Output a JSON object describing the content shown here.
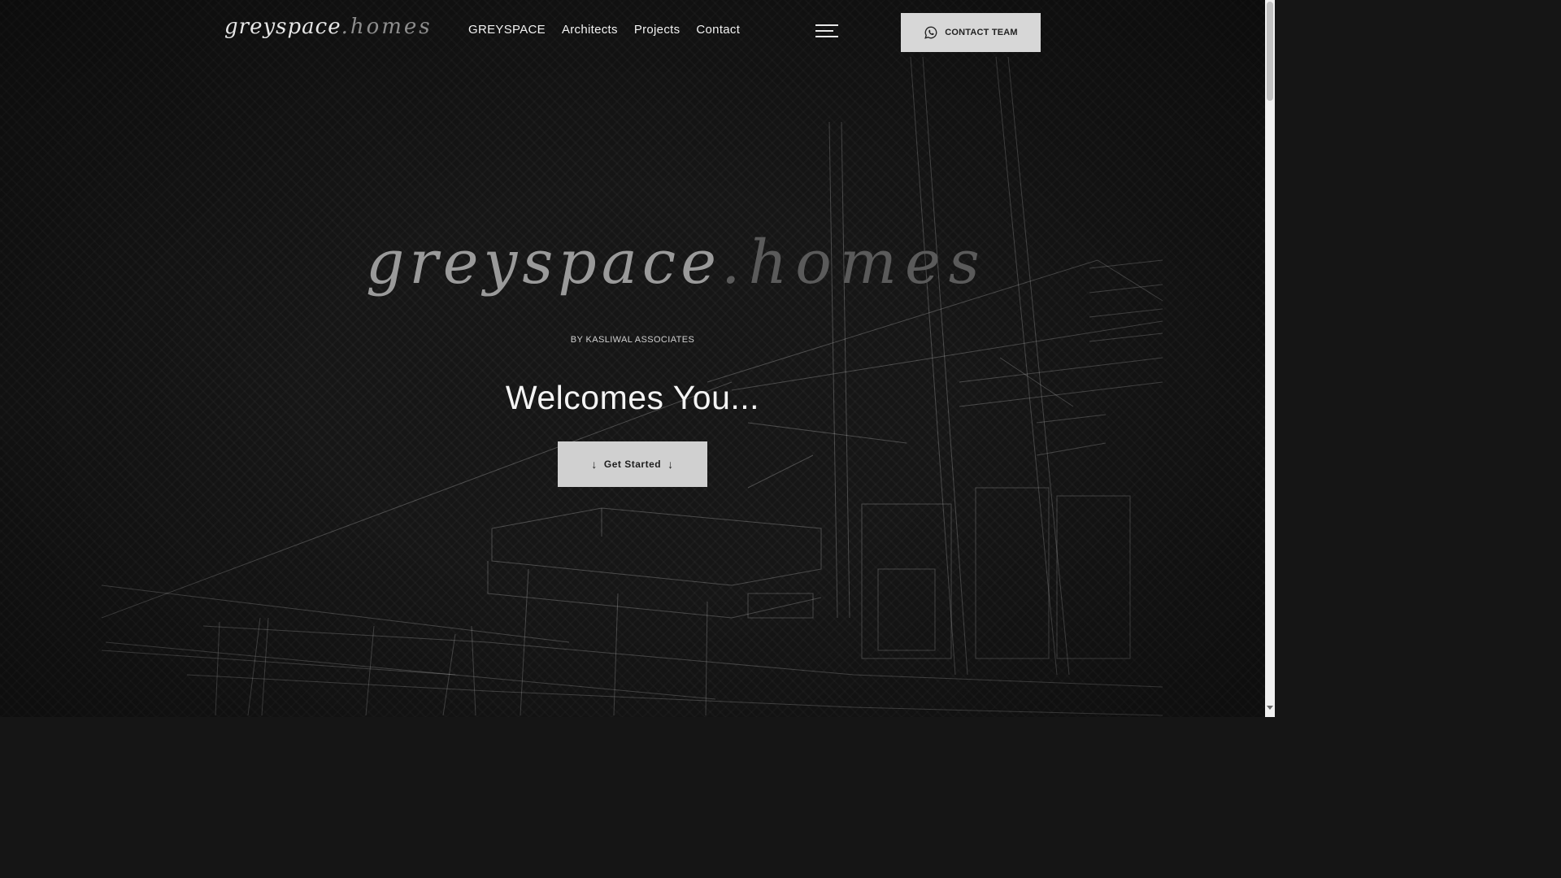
{
  "header": {
    "logo": {
      "part1": "greyspace",
      "part2": ".homes"
    },
    "nav": [
      "GREYSPACE",
      "Architects",
      "Projects",
      "Contact"
    ],
    "contact_button": "CONTACT TEAM"
  },
  "hero": {
    "logo": {
      "part1": "greyspace",
      "part2": ".homes"
    },
    "byline": "BY KASLIWAL ASSOCIATES",
    "headline": "Welcomes You...",
    "cta": {
      "arrow_left": "↓",
      "label": "Get Started",
      "arrow_right": "↓"
    }
  },
  "colors": {
    "background": "#161616",
    "button": "#d0d0d0",
    "text": "#f4f4f4"
  },
  "icons": [
    "whatsapp-icon",
    "hamburger-menu-icon"
  ]
}
